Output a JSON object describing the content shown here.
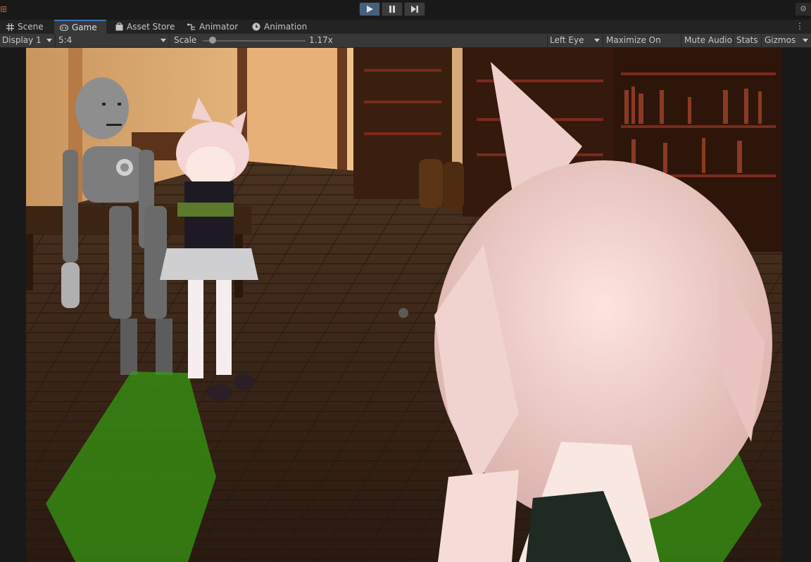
{
  "toolbar": {
    "play_icon": "play-icon",
    "pause_icon": "pause-icon",
    "step_icon": "step-icon"
  },
  "tabs": [
    {
      "label": "Scene",
      "icon": "grid-icon"
    },
    {
      "label": "Game",
      "icon": "gamepad-icon",
      "active": true
    },
    {
      "label": "Asset Store",
      "icon": "bag-icon"
    },
    {
      "label": "Animator",
      "icon": "animator-icon"
    },
    {
      "label": "Animation",
      "icon": "clock-icon"
    }
  ],
  "game_bar": {
    "display": "Display 1",
    "aspect": "5:4",
    "scale_label": "Scale",
    "scale_value": "1.17x",
    "eye": "Left Eye",
    "maximize": "Maximize On Play",
    "mute": "Mute Audio",
    "stats": "Stats",
    "gizmos": "Gizmos"
  },
  "colors": {
    "accent": "#3a79bb",
    "play_active": "#46607c"
  }
}
